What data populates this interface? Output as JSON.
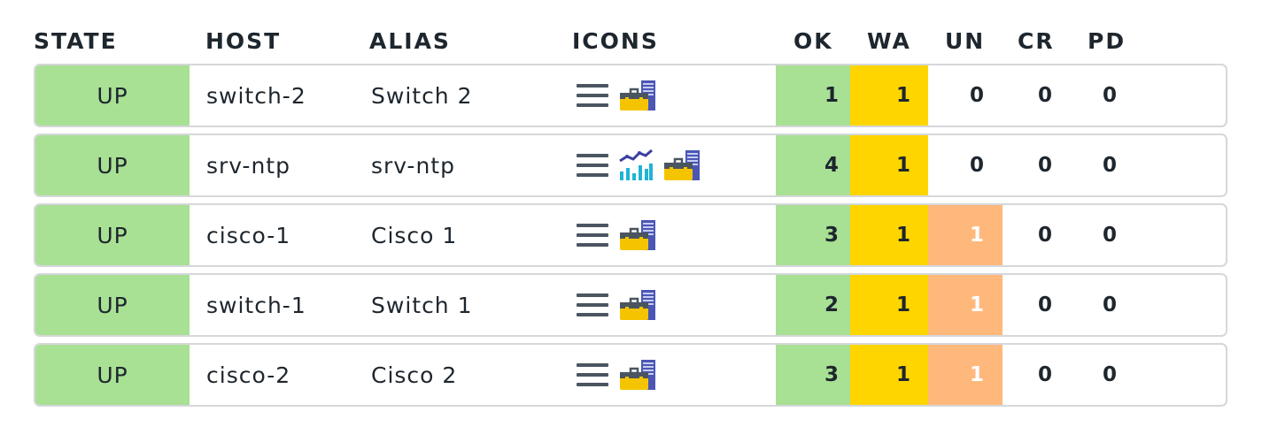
{
  "columns": {
    "state": "STATE",
    "host": "HOST",
    "alias": "ALIAS",
    "icons": "ICONS",
    "ok": "OK",
    "wa": "WA",
    "un": "UN",
    "cr": "CR",
    "pd": "PD"
  },
  "colors": {
    "ok": "#a8e094",
    "warn": "#ffd500",
    "unknown": "#ffb87b",
    "border": "#d5d7da"
  },
  "rows": [
    {
      "state": "UP",
      "host": "switch-2",
      "alias": "Switch 2",
      "icons": [
        "menu-icon",
        "host-toolbox-icon"
      ],
      "ok": "1",
      "wa": "1",
      "un": "0",
      "cr": "0",
      "pd": "0"
    },
    {
      "state": "UP",
      "host": "srv-ntp",
      "alias": "srv-ntp",
      "icons": [
        "menu-icon",
        "performance-graph-icon",
        "host-toolbox-icon"
      ],
      "ok": "4",
      "wa": "1",
      "un": "0",
      "cr": "0",
      "pd": "0"
    },
    {
      "state": "UP",
      "host": "cisco-1",
      "alias": "Cisco 1",
      "icons": [
        "menu-icon",
        "host-toolbox-icon"
      ],
      "ok": "3",
      "wa": "1",
      "un": "1",
      "cr": "0",
      "pd": "0"
    },
    {
      "state": "UP",
      "host": "switch-1",
      "alias": "Switch 1",
      "icons": [
        "menu-icon",
        "host-toolbox-icon"
      ],
      "ok": "2",
      "wa": "1",
      "un": "1",
      "cr": "0",
      "pd": "0"
    },
    {
      "state": "UP",
      "host": "cisco-2",
      "alias": "Cisco 2",
      "icons": [
        "menu-icon",
        "host-toolbox-icon"
      ],
      "ok": "3",
      "wa": "1",
      "un": "1",
      "cr": "0",
      "pd": "0"
    }
  ]
}
